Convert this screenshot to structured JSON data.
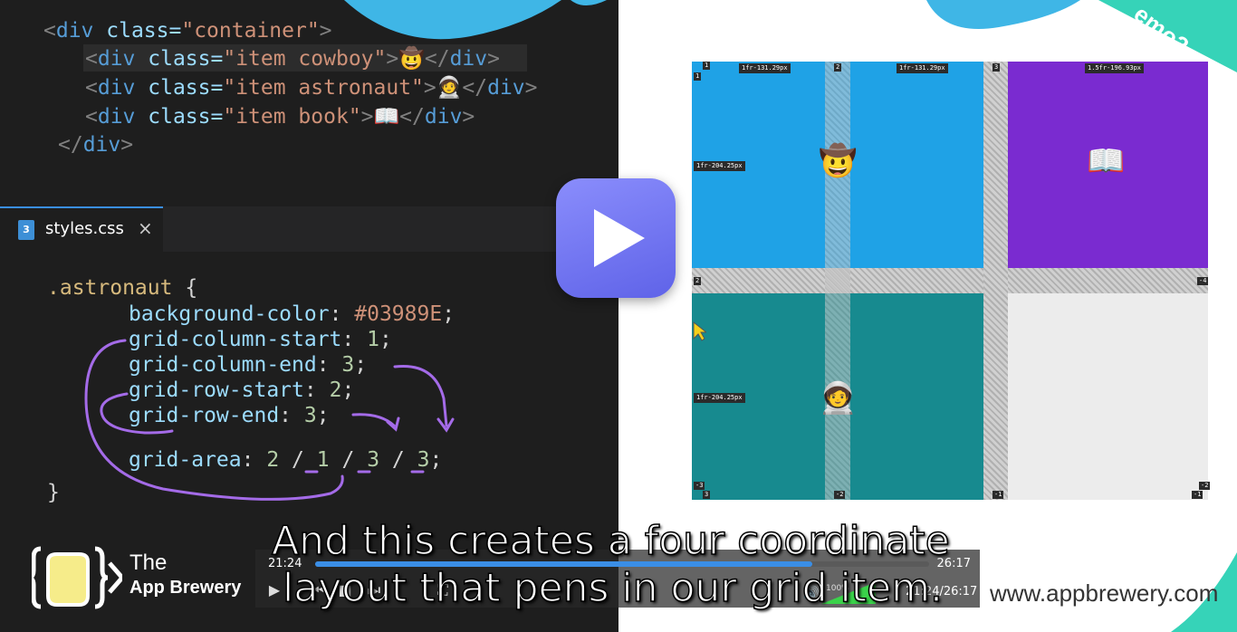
{
  "html_code": {
    "line1": {
      "open": "<",
      "tag": "div",
      "attr": " class=",
      "val": "\"container\"",
      "close": ">"
    },
    "line2": {
      "open": "<",
      "tag": "div",
      "attr": " class=",
      "val": "\"item cowboy\"",
      "close": ">",
      "content": "🤠",
      "end_open": "</",
      "end_tag": "div",
      "end_close": ">"
    },
    "line3": {
      "open": "<",
      "tag": "div",
      "attr": " class=",
      "val": "\"item astronaut\"",
      "close": ">",
      "content": "🧑‍🚀",
      "end_open": "</",
      "end_tag": "div",
      "end_close": ">"
    },
    "line4": {
      "open": "<",
      "tag": "div",
      "attr": " class=",
      "val": "\"item book\"",
      "close": ">",
      "content": "📖",
      "end_open": "</",
      "end_tag": "div",
      "end_close": ">"
    },
    "line5": {
      "open": "</",
      "tag": "div",
      "close": ">"
    }
  },
  "editor_tab": {
    "icon_text": "3",
    "label": "styles.css",
    "close": "×"
  },
  "css_code": {
    "selector": ".astronaut",
    "brace_open": " {",
    "p1": "background-color",
    "v1": "#03989E",
    "p2": "grid-column-start",
    "v2": "1",
    "p3": "grid-column-end",
    "v3": "3",
    "p4": "grid-row-start",
    "v4": "2",
    "p5": "grid-row-end",
    "v5": "3",
    "p6": "grid-area",
    "v6a": "2",
    "v6b": "1",
    "v6c": "3",
    "v6d": "3",
    "slash": "/",
    "colon": ": ",
    "semi": ";",
    "brace_close": "}"
  },
  "brand": {
    "line1": "The",
    "line2": "App Brewery"
  },
  "preview": {
    "demo_label": "emo3",
    "url": "www.appbrewery.com",
    "col_labels": [
      "1fr-131.29px",
      "1fr-131.29px",
      "1.5fr-196.93px"
    ],
    "row_labels": [
      "1fr-204.25px",
      "1fr-204.25px"
    ],
    "line_numbers_top": [
      "1",
      "2",
      "3"
    ],
    "line_numbers_left": [
      "1",
      "2",
      "3"
    ],
    "line_numbers_neg": [
      "-3",
      "-2",
      "-1",
      "-4",
      "-1",
      "-2",
      "-1"
    ],
    "cowboy": "🤠",
    "book": "📖",
    "astronaut": "🧑‍🚀",
    "colors": {
      "cowboy": "#1fa2e6",
      "book": "#7a2bd0",
      "astronaut": "#178a8f",
      "empty": "#ececec"
    }
  },
  "subtitles": {
    "line1": "And this creates a four coordinate",
    "line2": "layout that pens in our grid item."
  },
  "player": {
    "elapsed": "21:24",
    "total": "26:17",
    "readout": "21:24/26:17",
    "progress": 0.81,
    "volume_pct": "100%",
    "buttons": {
      "play": "▶",
      "prev": "⏮",
      "stop": "■",
      "next": "⏭",
      "fullscreen": "⛶"
    }
  },
  "accent_colors": {
    "editor_bg": "#1e1e1e",
    "play_button": "#7376f2",
    "seek": "#3a8ee6"
  }
}
